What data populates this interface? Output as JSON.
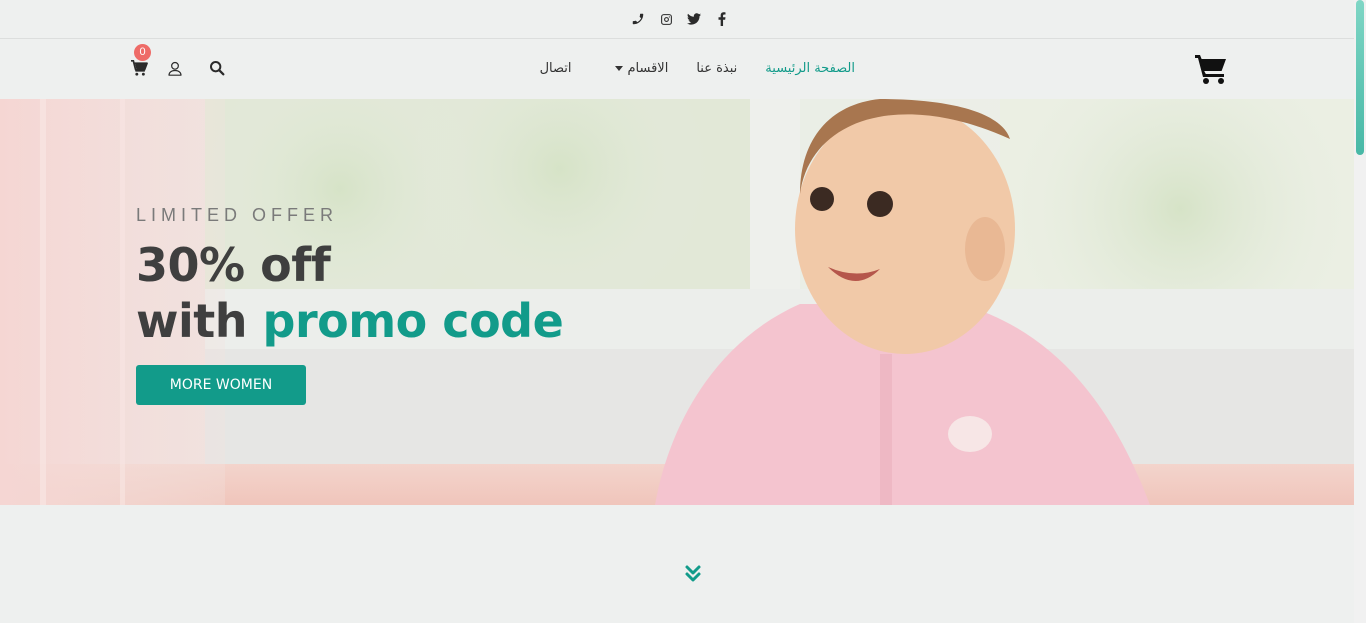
{
  "social": {
    "icons": [
      "phone-icon",
      "instagram-icon",
      "twitter-icon",
      "facebook-icon"
    ]
  },
  "nav": {
    "cart_count": "0",
    "links": {
      "home": "الصفحة الرئيسية",
      "about": "نبذة عنا",
      "categories": "الاقسام",
      "contact": "اتصال"
    },
    "active_color": "#129b8a"
  },
  "hero": {
    "eyebrow": "LIMITED OFFER",
    "headline_line1": "30% off",
    "headline_line2_plain": "with",
    "headline_line2_accent": "promo code",
    "cta_label": "MORE WOMEN",
    "accent_color": "#129b8a"
  }
}
